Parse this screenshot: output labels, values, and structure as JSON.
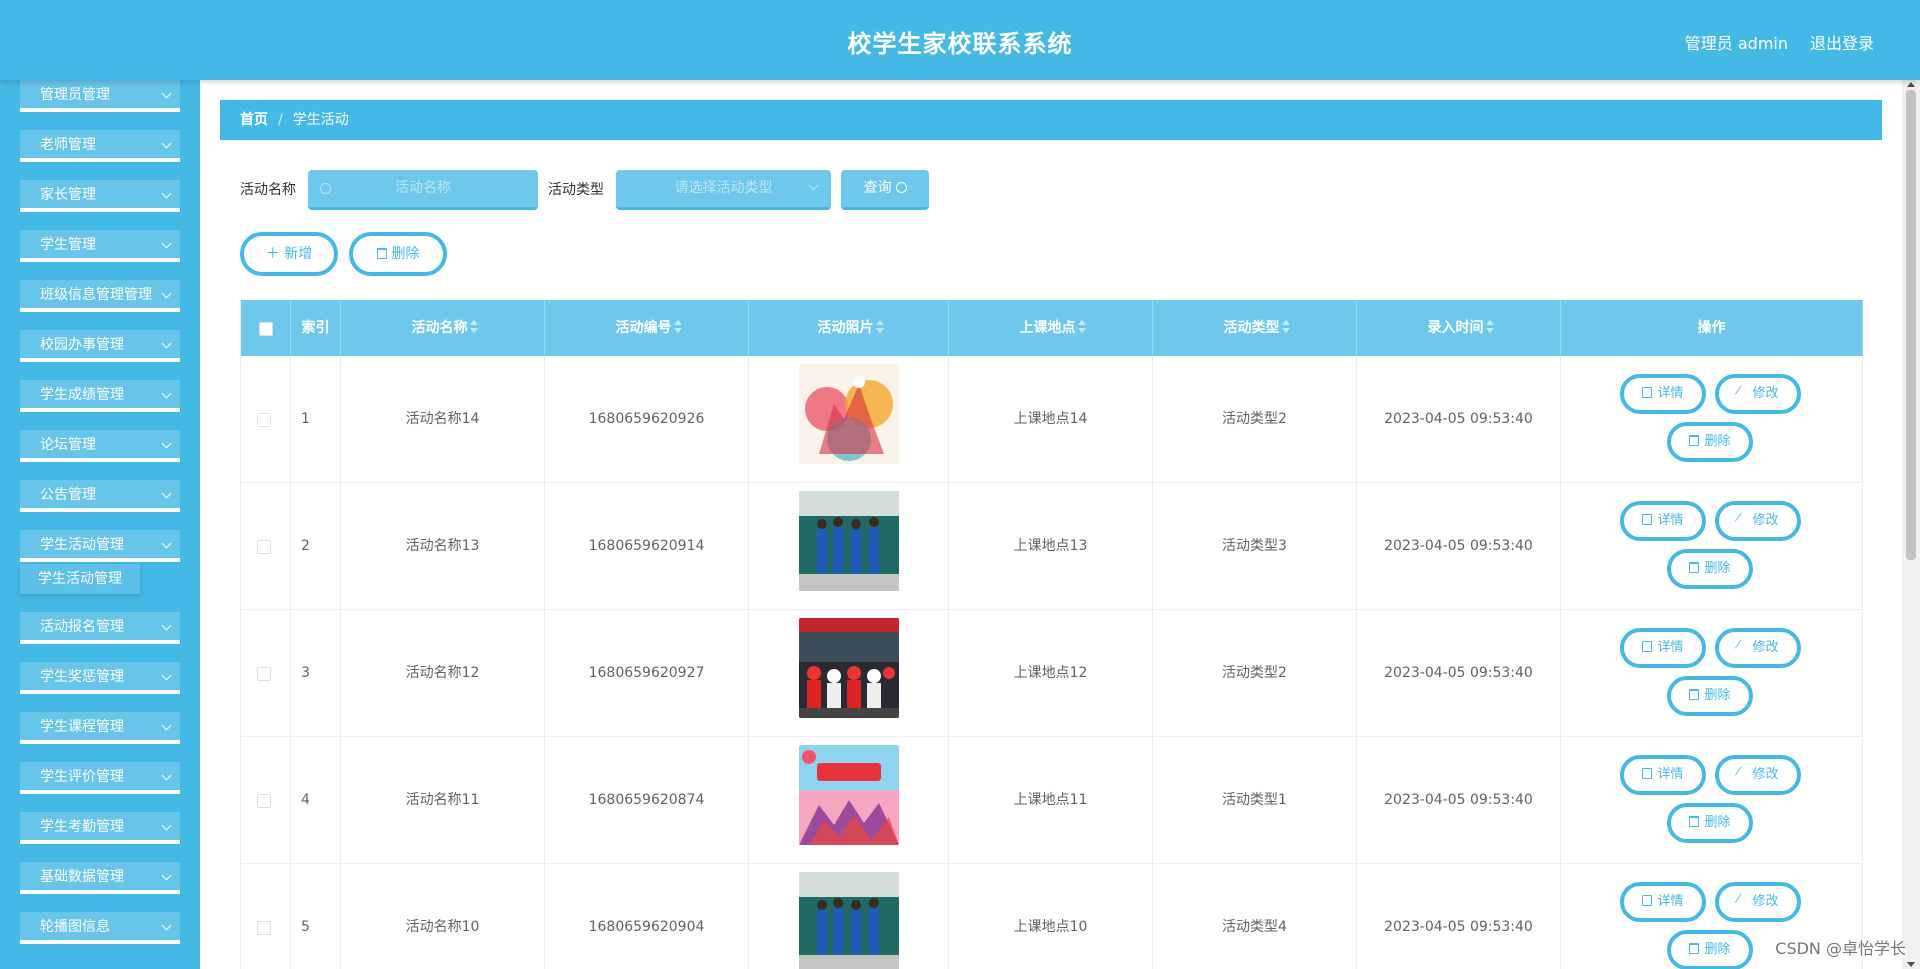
{
  "header": {
    "title": "校学生家校联系系统",
    "user": "管理员 admin",
    "logout": "退出登录"
  },
  "sidebar": {
    "items": [
      {
        "label": "管理员管理"
      },
      {
        "label": "老师管理"
      },
      {
        "label": "家长管理"
      },
      {
        "label": "学生管理"
      },
      {
        "label": "班级信息管理管理"
      },
      {
        "label": "校园办事管理"
      },
      {
        "label": "学生成绩管理"
      },
      {
        "label": "论坛管理"
      },
      {
        "label": "公告管理"
      },
      {
        "label": "学生活动管理"
      },
      {
        "label": "活动报名管理"
      },
      {
        "label": "学生奖惩管理"
      },
      {
        "label": "学生课程管理"
      },
      {
        "label": "学生评价管理"
      },
      {
        "label": "学生考勤管理"
      },
      {
        "label": "基础数据管理"
      },
      {
        "label": "轮播图信息"
      }
    ],
    "active_sub": "学生活动管理"
  },
  "breadcrumb": {
    "home": "首页",
    "sep": "/",
    "current": "学生活动"
  },
  "search": {
    "name_label": "活动名称",
    "name_placeholder": "活动名称",
    "type_label": "活动类型",
    "type_placeholder": "请选择活动类型",
    "query": "查询"
  },
  "actions": {
    "add": "新增",
    "delete": "删除"
  },
  "table": {
    "headers": [
      "索引",
      "活动名称",
      "活动编号",
      "活动照片",
      "上课地点",
      "活动类型",
      "录入时间",
      "操作"
    ],
    "rows": [
      {
        "idx": "1",
        "name": "活动名称14",
        "code": "1680659620926",
        "place": "上课地点14",
        "type": "活动类型2",
        "time": "2023-04-05 09:53:40"
      },
      {
        "idx": "2",
        "name": "活动名称13",
        "code": "1680659620914",
        "place": "上课地点13",
        "type": "活动类型3",
        "time": "2023-04-05 09:53:40"
      },
      {
        "idx": "3",
        "name": "活动名称12",
        "code": "1680659620927",
        "place": "上课地点12",
        "type": "活动类型2",
        "time": "2023-04-05 09:53:40"
      },
      {
        "idx": "4",
        "name": "活动名称11",
        "code": "1680659620874",
        "place": "上课地点11",
        "type": "活动类型1",
        "time": "2023-04-05 09:53:40"
      },
      {
        "idx": "5",
        "name": "活动名称10",
        "code": "1680659620904",
        "place": "上课地点10",
        "type": "活动类型4",
        "time": "2023-04-05 09:53:40"
      }
    ],
    "ops": {
      "detail": "详情",
      "edit": "修改",
      "delete": "删除"
    }
  },
  "watermark": "CSDN @卓怡学长",
  "colors": {
    "primary": "#44b9e6",
    "light": "#6ec8eb"
  }
}
